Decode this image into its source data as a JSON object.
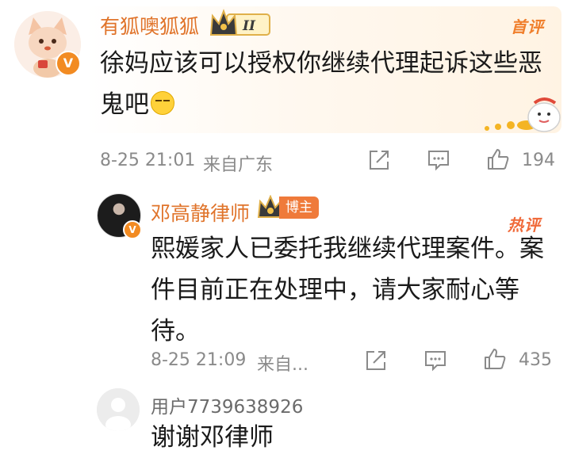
{
  "comment1": {
    "username": "有狐噢狐狐",
    "level_badge": "II",
    "avatar_badge": "V",
    "tag": "首评",
    "text": "徐妈应该可以授权你继续代理起诉这些恶鬼吧",
    "emoji": "thinking-emoji",
    "time": "8-25 21:01",
    "location": "来自广东",
    "like_count": "194"
  },
  "reply1": {
    "username": "邓高静律师",
    "role_badge": "博主",
    "avatar_badge": "V",
    "tag": "热评",
    "text": "熙媛家人已委托我继续代理案件。案件目前正在处理中，请大家耐心等待。",
    "time": "8-25 21:09",
    "location": "来自...",
    "like_count": "435"
  },
  "reply2": {
    "username": "用户7739638926",
    "text": "谢谢邓律师"
  },
  "colors": {
    "username": "#e0742b",
    "badge_orange": "#ef7a3a",
    "meta_gray": "#8a8a8a"
  },
  "icons": [
    "share-icon",
    "comment-icon",
    "like-icon",
    "crown-icon"
  ]
}
